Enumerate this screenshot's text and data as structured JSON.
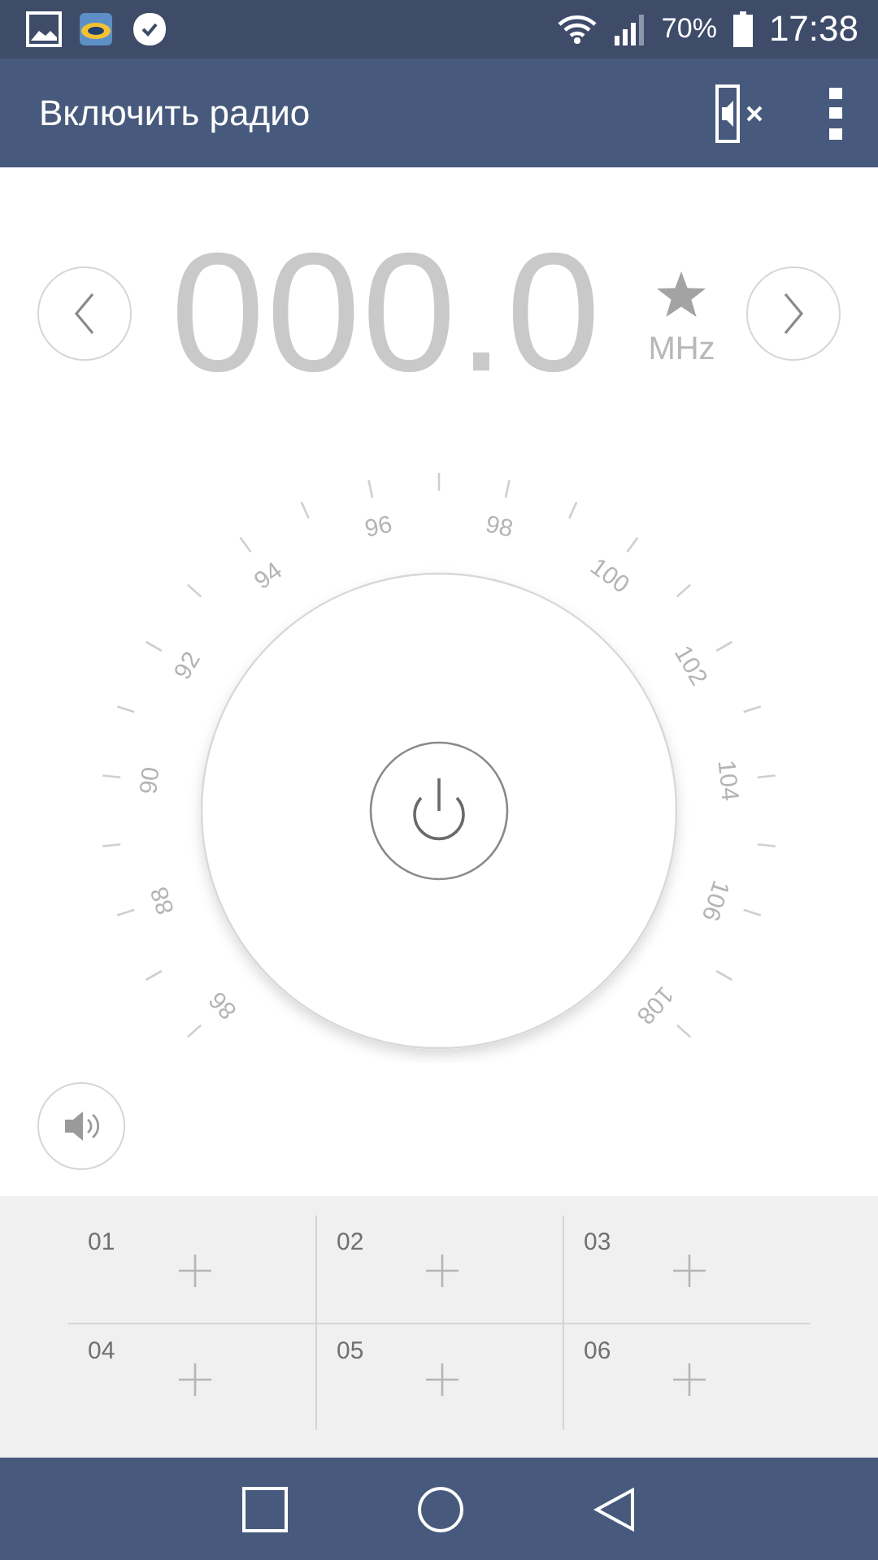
{
  "status_bar": {
    "battery": "70%",
    "time": "17:38"
  },
  "app_bar": {
    "title": "Включить радио"
  },
  "tuner": {
    "frequency": "000.0",
    "unit": "MHz",
    "dial_labels": [
      "86",
      "88",
      "90",
      "92",
      "94",
      "96",
      "98",
      "100",
      "102",
      "104",
      "106",
      "108"
    ]
  },
  "presets": [
    {
      "number": "01"
    },
    {
      "number": "02"
    },
    {
      "number": "03"
    },
    {
      "number": "04"
    },
    {
      "number": "05"
    },
    {
      "number": "06"
    }
  ]
}
